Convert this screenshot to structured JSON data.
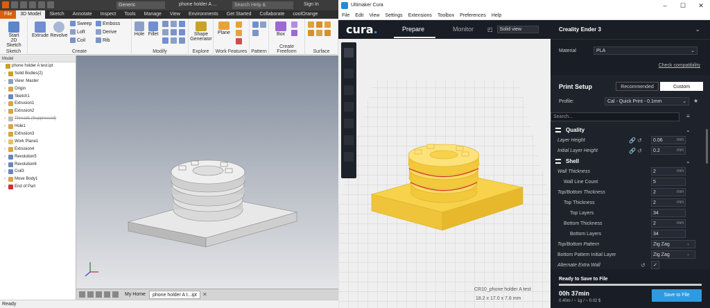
{
  "inventor": {
    "quick_access_combo": "Generic",
    "document_title": "phone holder A ...",
    "search_placeholder": "Search Help & Commands...",
    "sign_in": "Sign In",
    "tabs": [
      "File",
      "3D Model",
      "Sketch",
      "Annotate",
      "Inspect",
      "Tools",
      "Manage",
      "View",
      "Environments",
      "Get Started",
      "Collaborate",
      "coolOrange"
    ],
    "active_tab": "3D Model",
    "ribbon": {
      "start_sketch": "Start\n2D Sketch",
      "group_sketch": "Sketch",
      "extrude": "Extrude",
      "revolve": "Revolve",
      "sweep": "Sweep",
      "loft": "Loft",
      "coil": "Coil",
      "emboss": "Emboss",
      "derive": "Derive",
      "rib": "Rib",
      "group_create": "Create",
      "hole": "Hole",
      "fillet": "Fillet",
      "group_modify": "Modify",
      "shape_generator": "Shape\nGenerator",
      "group_explore": "Explore",
      "plane": "Plane",
      "group_work_features": "Work Features",
      "group_pattern": "Pattern",
      "box": "Box",
      "group_create_freeform": "Create Freeform",
      "group_surface": "Surface"
    },
    "browser": {
      "header": "Model",
      "items": [
        {
          "label": "phone holder A test.ipt",
          "indent": 0,
          "struck": false,
          "color": "#c9a227"
        },
        {
          "label": "Solid Bodies(2)",
          "indent": 1,
          "struck": false,
          "color": "#c9a227"
        },
        {
          "label": "View: Master",
          "indent": 1,
          "struck": false,
          "color": "#8aa0b8"
        },
        {
          "label": "Origin",
          "indent": 1,
          "struck": false,
          "color": "#d9a441"
        },
        {
          "label": "Sketch1",
          "indent": 1,
          "struck": false,
          "color": "#6a86b8"
        },
        {
          "label": "Extrusion1",
          "indent": 1,
          "struck": false,
          "color": "#d9a441"
        },
        {
          "label": "Extrusion2",
          "indent": 1,
          "struck": false,
          "color": "#d9a441"
        },
        {
          "label": "Thread1 (Suppressed)",
          "indent": 1,
          "struck": true,
          "color": "#bbbbbb"
        },
        {
          "label": "Hole1",
          "indent": 1,
          "struck": false,
          "color": "#d9a441"
        },
        {
          "label": "Extrusion3",
          "indent": 1,
          "struck": false,
          "color": "#d9a441"
        },
        {
          "label": "Work Plane1",
          "indent": 1,
          "struck": false,
          "color": "#e8c15a"
        },
        {
          "label": "Extrusion4",
          "indent": 1,
          "struck": false,
          "color": "#d9a441"
        },
        {
          "label": "Revolution5",
          "indent": 1,
          "struck": false,
          "color": "#6a86b8"
        },
        {
          "label": "Revolution6",
          "indent": 1,
          "struck": false,
          "color": "#6a86b8"
        },
        {
          "label": "Coil3",
          "indent": 1,
          "struck": false,
          "color": "#6a86b8"
        },
        {
          "label": "Move Body1",
          "indent": 1,
          "struck": false,
          "color": "#d9a441"
        },
        {
          "label": "End of Part",
          "indent": 1,
          "struck": false,
          "color": "#cc3333"
        }
      ]
    },
    "bottom_tabs": {
      "home": "My Home",
      "doc": "phone holder A t...ipt"
    },
    "status": "Ready"
  },
  "cura": {
    "window_title": "Ultimaker Cura",
    "menu": [
      "File",
      "Edit",
      "View",
      "Settings",
      "Extensions",
      "Toolbox",
      "Preferences",
      "Help"
    ],
    "brand": "cura",
    "stages": {
      "prepare": "Prepare",
      "monitor": "Monitor"
    },
    "view_mode": "Solid view",
    "machine": {
      "name": "Creality Ender 3",
      "material_label": "Material",
      "material_value": "PLA",
      "check_compat": "Check compatibility"
    },
    "setup": {
      "title": "Print Setup",
      "recommended": "Recommended",
      "custom": "Custom",
      "profile_label": "Profile:",
      "profile_value": "Cal - Quick Print - 0.1mm",
      "search_placeholder": "Search...",
      "rows": [
        {
          "kind": "cat",
          "label": "Quality"
        },
        {
          "kind": "field",
          "label": "Layer Height",
          "value": "0.06",
          "unit": "mm",
          "indent": 0,
          "italic": true,
          "icons": "🔗 ↺"
        },
        {
          "kind": "field",
          "label": "Initial Layer Height",
          "value": "0.2",
          "unit": "mm",
          "indent": 0,
          "italic": true,
          "icons": "🔗 ↺"
        },
        {
          "kind": "cat",
          "label": "Shell"
        },
        {
          "kind": "field",
          "label": "Wall Thickness",
          "value": "2",
          "unit": "mm",
          "indent": 0,
          "italic": true,
          "icons": ""
        },
        {
          "kind": "field",
          "label": "Wall Line Count",
          "value": "5",
          "unit": "",
          "indent": 1,
          "italic": false,
          "icons": ""
        },
        {
          "kind": "field",
          "label": "Top/Bottom Thickness",
          "value": "2",
          "unit": "mm",
          "indent": 0,
          "italic": true,
          "icons": ""
        },
        {
          "kind": "field",
          "label": "Top Thickness",
          "value": "2",
          "unit": "mm",
          "indent": 1,
          "italic": false,
          "icons": ""
        },
        {
          "kind": "field",
          "label": "Top Layers",
          "value": "34",
          "unit": "",
          "indent": 2,
          "italic": false,
          "icons": ""
        },
        {
          "kind": "field",
          "label": "Bottom Thickness",
          "value": "2",
          "unit": "mm",
          "indent": 1,
          "italic": false,
          "icons": ""
        },
        {
          "kind": "field",
          "label": "Bottom Layers",
          "value": "34",
          "unit": "",
          "indent": 2,
          "italic": false,
          "icons": ""
        },
        {
          "kind": "select",
          "label": "Top/Bottom Pattern",
          "value": "Zig Zag",
          "indent": 0,
          "italic": true
        },
        {
          "kind": "select",
          "label": "Bottom Pattern Initial Layer",
          "value": "Zig Zag",
          "indent": 0,
          "italic": false
        },
        {
          "kind": "check",
          "label": "Alternate Extra Wall",
          "value": "✓",
          "indent": 0,
          "italic": true,
          "icons": "↺"
        }
      ]
    },
    "footer": {
      "ready": "Ready to Save to File",
      "progress": 1.0,
      "time": "00h 37min",
      "material": "0.40m / ~ 1g / ~ 0.02 $",
      "save": "Save to File"
    },
    "viewport_overlay": {
      "name": "CR10_phone holder A test",
      "dims": "18.2 x 17.0 x 7.8 mm"
    },
    "colors": {
      "accent": "#2f9ae0",
      "model": "#f7d24a",
      "dark": "#191d25"
    }
  }
}
